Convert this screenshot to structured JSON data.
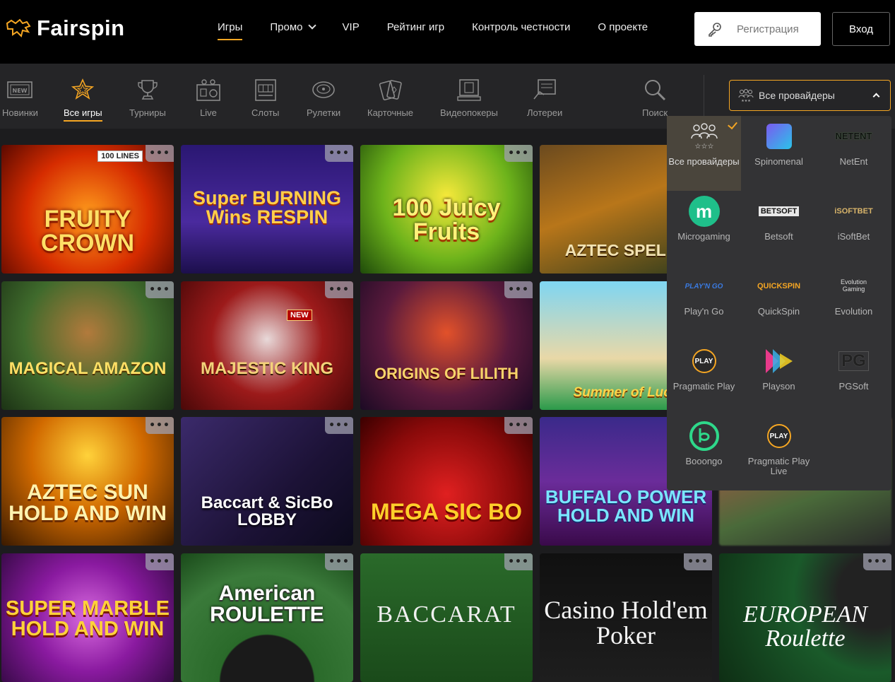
{
  "brand": {
    "name": "Fairspin",
    "accent": "#f5a623"
  },
  "topnav": [
    {
      "label": "Игры",
      "active": true
    },
    {
      "label": "Промо",
      "dropdown": true
    },
    {
      "label": "VIP"
    },
    {
      "label": "Рейтинг игр"
    },
    {
      "label": "Контроль честности"
    },
    {
      "label": "О проекте"
    }
  ],
  "auth": {
    "register_label": "Регистрация",
    "login_label": "Вход"
  },
  "categories": [
    {
      "label": "Новинки",
      "icon": "new-icon"
    },
    {
      "label": "Все игры",
      "icon": "stars-icon",
      "active": true
    },
    {
      "label": "Турниры",
      "icon": "trophy-icon"
    },
    {
      "label": "Live",
      "icon": "live-icon"
    },
    {
      "label": "Слоты",
      "icon": "slot-icon"
    },
    {
      "label": "Рулетки",
      "icon": "roulette-icon"
    },
    {
      "label": "Карточные",
      "icon": "cards-icon"
    },
    {
      "label": "Видеопокеры",
      "icon": "videopoker-icon"
    },
    {
      "label": "Лотереи",
      "icon": "lottery-icon"
    },
    {
      "label": "Поиск",
      "icon": "search-icon"
    }
  ],
  "provider_filter": {
    "label": "Все провайдеры"
  },
  "games": [
    {
      "title": "FRUITY CROWN",
      "badge": "100 LINES"
    },
    {
      "title": "Super BURNING Wins RESPIN"
    },
    {
      "title": "100 Juicy Fruits"
    },
    {
      "title": "AZTEC SPELLS"
    },
    {
      "title": "MAGICAL AMAZON"
    },
    {
      "title": "MAJESTIC KING",
      "badge": "NEW"
    },
    {
      "title": "ORIGINS OF LILITH"
    },
    {
      "title": "Summer of Luck"
    },
    {
      "title": "AZTEC SUN HOLD AND WIN"
    },
    {
      "title": "Baccart & SicBo LOBBY"
    },
    {
      "title": "MEGA SIC BO"
    },
    {
      "title": "BUFFALO POWER HOLD AND WIN"
    },
    {
      "title": ""
    },
    {
      "title": "SUPER MARBLE HOLD AND WIN"
    },
    {
      "title": "American ROULETTE"
    },
    {
      "title": "BACCARAT"
    },
    {
      "title": "Casino Hold'em Poker"
    },
    {
      "title": "EUROPEAN Roulette"
    }
  ],
  "more_label": "•••",
  "providers": [
    {
      "label": "Все провайдеры",
      "selected": true,
      "icon": "all-providers-icon"
    },
    {
      "label": "Spinomenal",
      "icon": "spinomenal-logo"
    },
    {
      "label": "NetEnt",
      "icon": "netent-logo",
      "logo_text": "NETENT"
    },
    {
      "label": "Microgaming",
      "icon": "microgaming-logo"
    },
    {
      "label": "Betsoft",
      "icon": "betsoft-logo",
      "logo_text": "BETSOFT"
    },
    {
      "label": "iSoftBet",
      "icon": "isoftbet-logo",
      "logo_text": "iSOFTBET"
    },
    {
      "label": "Play'n Go",
      "icon": "playngo-logo",
      "logo_text": "PLAY'N GO"
    },
    {
      "label": "QuickSpin",
      "icon": "quickspin-logo",
      "logo_text": "QUICKSPIN"
    },
    {
      "label": "Evolution",
      "icon": "evolution-logo",
      "logo_text": "Evolution Gaming"
    },
    {
      "label": "Pragmatic Play",
      "icon": "pragmatic-logo",
      "logo_text": "PLAY"
    },
    {
      "label": "Playson",
      "icon": "playson-logo"
    },
    {
      "label": "PGSoft",
      "icon": "pgsoft-logo",
      "logo_text": "PG"
    },
    {
      "label": "Booongo",
      "icon": "booongo-logo"
    },
    {
      "label": "Pragmatic Play Live",
      "icon": "pragmatic-live-logo",
      "logo_text": "PLAY"
    }
  ]
}
